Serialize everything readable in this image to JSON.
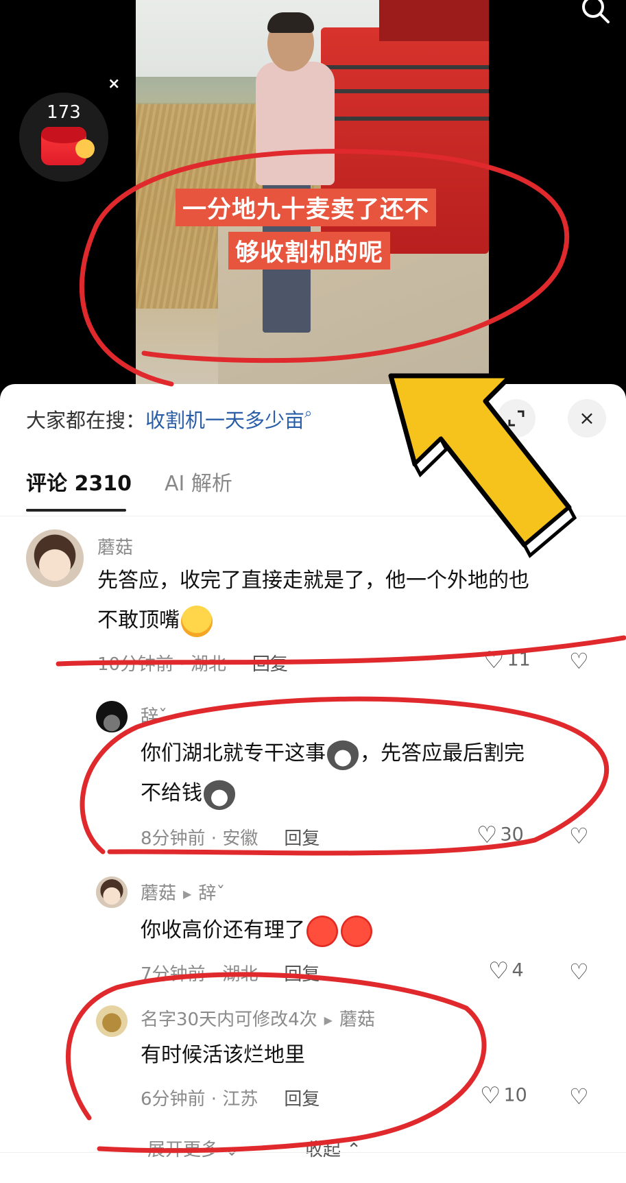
{
  "video": {
    "caption_line1": "一分地九十麦卖了还不",
    "caption_line2": "够收割机的呢",
    "red_packet_count": "173",
    "red_packet_close": "×",
    "search_icon": "search-icon"
  },
  "panel": {
    "hot_search_prefix": "大家都在搜：",
    "hot_search_query": "收割机一天多少亩",
    "hot_search_icon": "⌕",
    "expand_icon": "expand-icon",
    "close_label": "×",
    "tabs": [
      {
        "label": "评论 2310",
        "active": true
      },
      {
        "label": "AI 解析",
        "active": false
      }
    ]
  },
  "comments": [
    {
      "username": "蘑菇",
      "reply_to": "",
      "text_line1": "先答应，收完了直接走就是了，他一个外地的也",
      "text_line2": "不敢顶嘴",
      "emoji": "laughing-crying-emoji",
      "time": "10分钟前 · 湖北",
      "reply_label": "回复",
      "likes": "11"
    },
    {
      "username": "辞ˇ",
      "reply_to": "",
      "text_line1": "你们湖北就专干这事",
      "text_line1b": "，先答应最后割完",
      "text_line2": "不给钱",
      "emoji": "dog-emoji",
      "time": "8分钟前 · 安徽",
      "reply_label": "回复",
      "likes": "30"
    },
    {
      "username": "蘑菇",
      "reply_to": "辞ˇ",
      "text_line1": "你收高价还有理了",
      "emoji": "angry-emoji",
      "time": "7分钟前 · 湖北",
      "reply_label": "回复",
      "likes": "4"
    },
    {
      "username": "名字30天内可修改4次",
      "reply_to": "蘑菇",
      "text_line1": "有时候活该烂地里",
      "time": "6分钟前 · 江苏",
      "reply_label": "回复",
      "likes": "10"
    }
  ],
  "footer": {
    "expand_more": "展开更多 ⌄",
    "collapse": "收起 ⌃"
  },
  "colors": {
    "accent_link": "#2a5da8",
    "annotation_red": "#e0292c",
    "arrow_yellow": "#f6c21c"
  }
}
